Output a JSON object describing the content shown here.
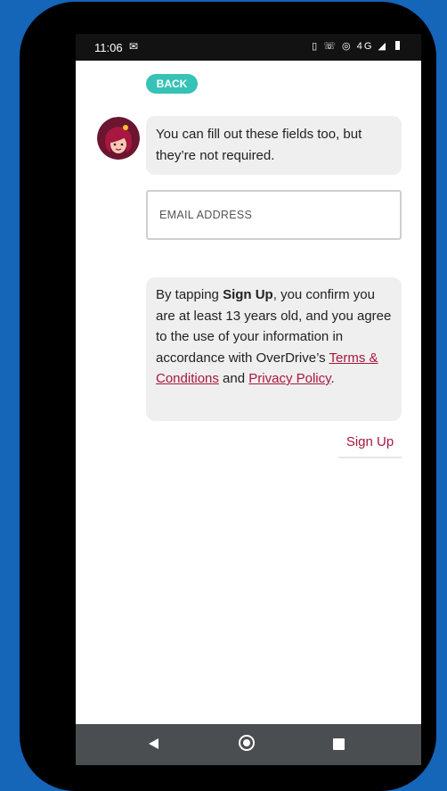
{
  "status_bar": {
    "time": "11:06",
    "notification_icon": "outlook-icon",
    "icons_text": "•• ☎ ◎ 4G"
  },
  "back_label": "BACK",
  "message1": "You can fill out these fields too, but they’re not required.",
  "email": {
    "placeholder": "EMAIL ADDRESS",
    "value": ""
  },
  "legal": {
    "prefix": "By tapping ",
    "sign_up_bold": "Sign Up",
    "middle": ", you confirm you are at least 13 years old, and you agree to the use of your information in accordance with OverDrive’s ",
    "terms_link": "Terms & Conditions",
    "and": " and ",
    "privacy_link": "Privacy Policy",
    "suffix": "."
  },
  "signup_label": "Sign Up",
  "colors": {
    "accent": "#a8173f",
    "back_button": "#36c2b6",
    "background": "#1565b8"
  }
}
